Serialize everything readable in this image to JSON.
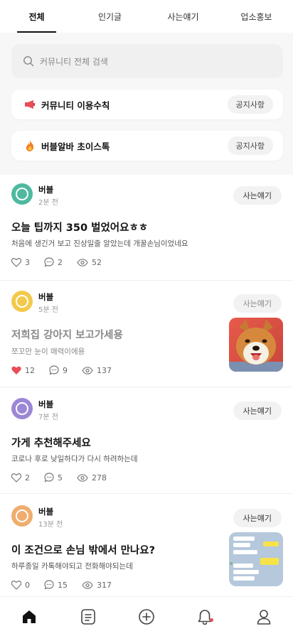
{
  "tabs": [
    {
      "label": "전체",
      "active": true
    },
    {
      "label": "인기글",
      "active": false
    },
    {
      "label": "사는얘기",
      "active": false
    },
    {
      "label": "업소홍보",
      "active": false
    }
  ],
  "search": {
    "placeholder": "커뮤니티 전체 검색"
  },
  "notices": [
    {
      "label": "커뮤니티 이용수칙",
      "button": "공지사항",
      "icon": "megaphone-icon"
    },
    {
      "label": "버블알바 초이스톡",
      "button": "공지사항",
      "icon": "fire-icon"
    }
  ],
  "posts": [
    {
      "author": "버블",
      "time": "2분 전",
      "category": "사는얘기",
      "title": "오늘 팁까지 350 벌었어요ㅎㅎ",
      "body": "처음에 생긴거 보고 진상일줄 알았는데 개꿀손님이었네요",
      "likes": "3",
      "comments": "2",
      "views": "52",
      "avatar_color": "#4fb99f",
      "liked": false,
      "faded": false,
      "thumbnail": null
    },
    {
      "author": "버블",
      "time": "5분 전",
      "category": "사는얘기",
      "title": "저희집 강아지 보고가세용",
      "body": "쪼꼬만 눈이 매력이에용",
      "likes": "12",
      "comments": "9",
      "views": "137",
      "avatar_color": "#f2c94c",
      "liked": true,
      "faded": true,
      "thumbnail": "dog-photo"
    },
    {
      "author": "버블",
      "time": "7분 전",
      "category": "사는얘기",
      "title": "가게 추천해주세요",
      "body": "코로나 후로 낮일하다가 다시 하려하는데",
      "likes": "2",
      "comments": "5",
      "views": "278",
      "avatar_color": "#9b87d6",
      "liked": false,
      "faded": false,
      "thumbnail": null
    },
    {
      "author": "버블",
      "time": "13분 전",
      "category": "사는얘기",
      "title": "이 조건으로 손님 밖에서 만나요?",
      "body": "하루종일 카톡해야되고 전화해야되는데",
      "likes": "0",
      "comments": "15",
      "views": "317",
      "avatar_color": "#f0ad6e",
      "liked": false,
      "faded": false,
      "thumbnail": "chat-screenshot"
    }
  ],
  "bottom_nav": [
    "home-icon",
    "board-icon",
    "write-icon",
    "notification-icon",
    "profile-icon"
  ],
  "colors": {
    "like_active": "#e94e58",
    "accent": "#111111"
  }
}
